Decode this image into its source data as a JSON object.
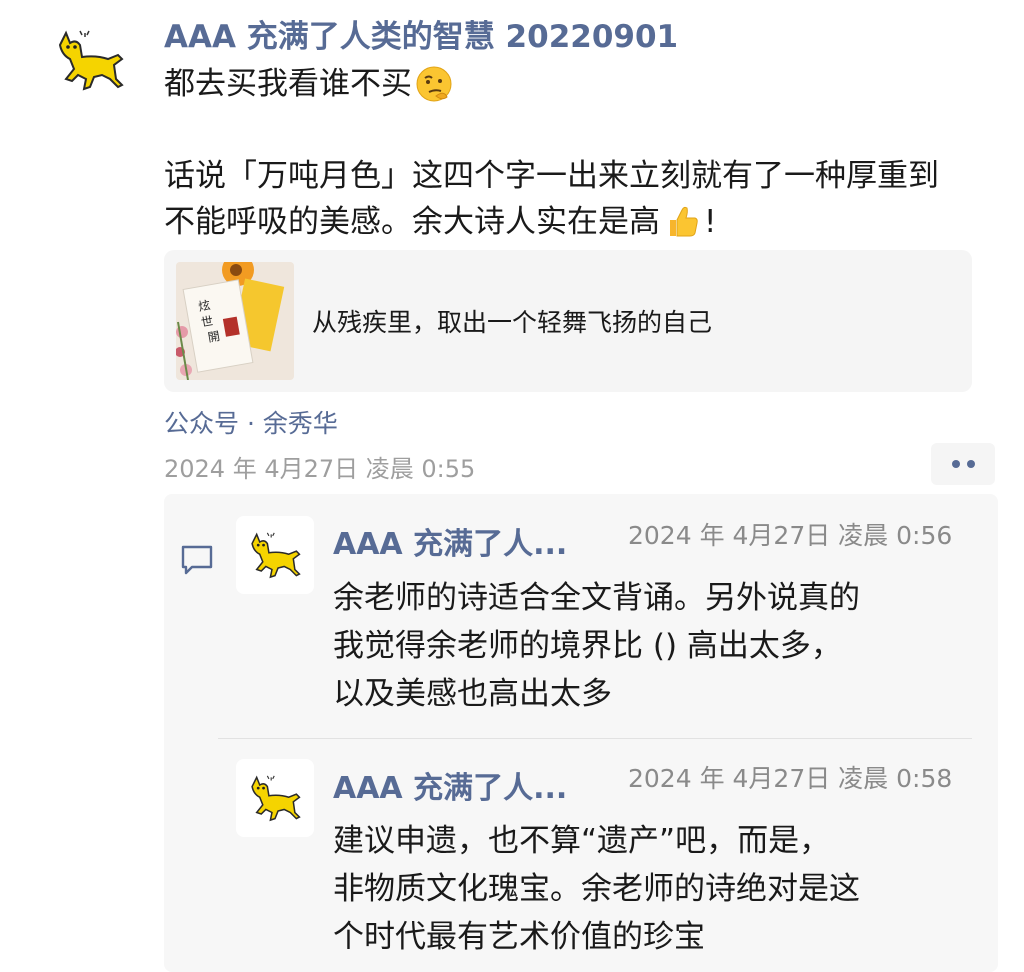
{
  "post": {
    "author": "AAA 充满了人类的智慧 20220901",
    "text_line1": "都去买我看谁不买",
    "text_line2": "话说「万吨月色」这四个字一出来立刻就有了一种厚重到",
    "text_line3_a": "不能呼吸的美感。余大诗人实在是高",
    "text_line3_b": "!",
    "link_card": {
      "title": "从残疾里，取出一个轻舞飞扬的自己"
    },
    "source": "公众号 · 余秀华",
    "timestamp": "2024 年 4月27日 凌晨 0:55"
  },
  "comments": [
    {
      "author": "AAA 充满了人...",
      "timestamp": "2024 年 4月27日 凌晨 0:56",
      "lines": [
        "余老师的诗适合全文背诵。另外说真的",
        "我觉得余老师的境界比 () 高出太多，",
        "以及美感也高出太多"
      ]
    },
    {
      "author": "AAA 充满了人...",
      "timestamp": "2024 年 4月27日 凌晨 0:58",
      "lines": [
        "建议申遗，也不算“遗产”吧，而是，",
        "非物质文化瑰宝。余老师的诗绝对是这",
        "个时代最有艺术价值的珍宝"
      ]
    }
  ],
  "icons": [
    "cat-avatar-icon",
    "thinking-face-emoji-icon",
    "thumbs-up-emoji-icon",
    "more-dots-icon",
    "comment-icon"
  ],
  "colors": {
    "link_blue": "#576b95",
    "panel_bg": "#f7f7f7",
    "card_bg": "#f5f5f5",
    "avatar_yellow": "#f5d400"
  }
}
